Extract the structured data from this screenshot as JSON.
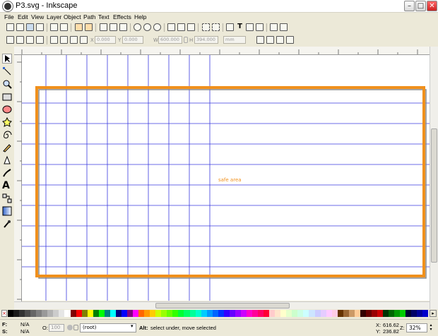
{
  "window": {
    "title": "P3.svg - Inkscape"
  },
  "menu": [
    "File",
    "Edit",
    "View",
    "Layer",
    "Object",
    "Path",
    "Text",
    "Effects",
    "Help"
  ],
  "toolctl": {
    "x_label": "X",
    "x_value": "0.000",
    "y_label": "Y",
    "y_value": "0.000",
    "w_label": "W",
    "w_value": "600.000",
    "h_label": "H",
    "h_value": "394.000",
    "unit": "mm"
  },
  "canvas": {
    "label": "safe area",
    "frame_color": "#f0901c",
    "guide_color": "#3a3adf"
  },
  "palette": [
    "#000000",
    "#1a1a1a",
    "#333333",
    "#4d4d4d",
    "#666666",
    "#808080",
    "#999999",
    "#b3b3b3",
    "#cccccc",
    "#e6e6e6",
    "#ffffff",
    "#800000",
    "#ff0000",
    "#808000",
    "#ffff00",
    "#008000",
    "#00ff00",
    "#008080",
    "#00ffff",
    "#000080",
    "#0000ff",
    "#800080",
    "#ff00ff",
    "#ff6600",
    "#ff9900",
    "#ffcc00",
    "#ccff00",
    "#99ff00",
    "#66ff00",
    "#33ff00",
    "#00ff33",
    "#00ff66",
    "#00ff99",
    "#00ffcc",
    "#00ccff",
    "#0099ff",
    "#0066ff",
    "#0033ff",
    "#3300ff",
    "#6600ff",
    "#9900ff",
    "#cc00ff",
    "#ff00cc",
    "#ff0099",
    "#ff0066",
    "#ff0033",
    "#ffcccc",
    "#ffe5cc",
    "#ffffcc",
    "#e5ffcc",
    "#ccffcc",
    "#ccffe5",
    "#ccffff",
    "#cce5ff",
    "#ccccff",
    "#e5ccff",
    "#ffccff",
    "#ffcce5",
    "#663300",
    "#996633",
    "#cc9966",
    "#ffcc99",
    "#330000",
    "#660000",
    "#990000",
    "#cc0000",
    "#003300",
    "#006600",
    "#009900",
    "#00cc00",
    "#000033",
    "#000066",
    "#000099",
    "#0000cc"
  ],
  "status": {
    "fill_label": "F:",
    "fill_value": "N/A",
    "stroke_label": "S:",
    "stroke_value": "N/A",
    "opacity_label": "O:",
    "opacity_value": "100",
    "layer": "(root)",
    "message_key": "Alt:",
    "message": "select under, move selected",
    "x_label": "X:",
    "x_value": "616.62",
    "y_label": "Y:",
    "y_value": "236.82",
    "zoom_label": "Z:",
    "zoom_value": "32%"
  }
}
